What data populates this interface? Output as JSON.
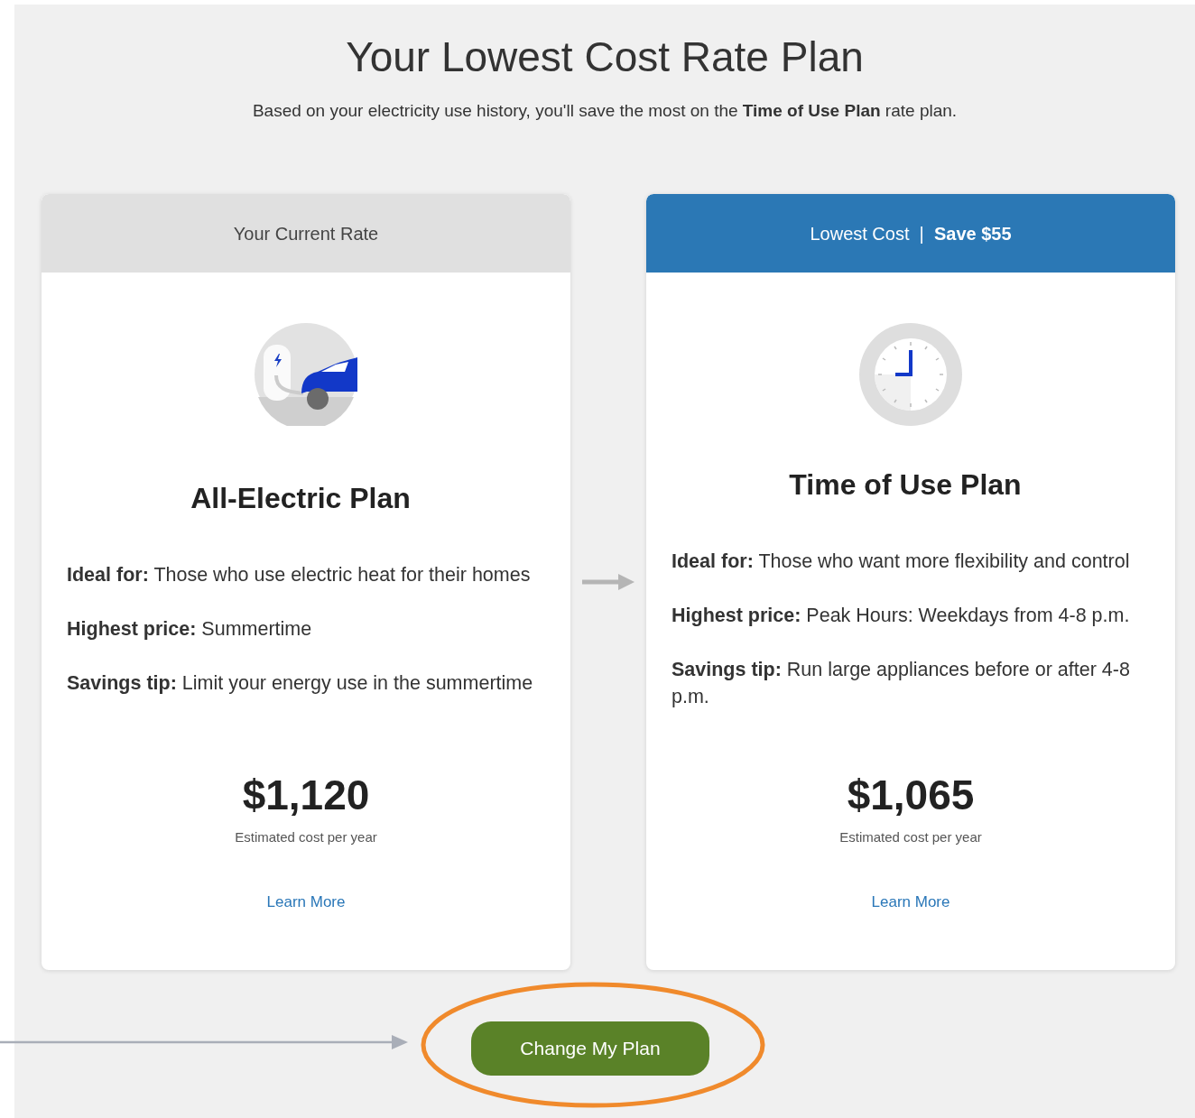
{
  "title": "Your Lowest Cost Rate Plan",
  "subtitle": "Based on your electricity use history, you'll save the most on the **Time of Use Plan** rate plan.",
  "plans": [
    {
      "kind": "current",
      "header": "Your Current Rate",
      "name": "All-Electric Plan",
      "details": [
        "**Ideal for:** Those who use electric heat for their homes",
        "**Highest price:** Summertime",
        "**Savings tip:** Limit your energy use in the summertime"
      ],
      "price": "$1,120",
      "price_note": "Estimated cost per year",
      "link": "Learn More"
    },
    {
      "kind": "lowest",
      "header": "Lowest Cost  |  **Save $55**",
      "name": "Time of Use Plan",
      "details": [
        "**Ideal for:** Those who want more flexibility and control",
        "**Highest price:** Peak Hours: Weekdays from 4-8 p.m.",
        "**Savings tip:** Run large appliances before or after 4-8 p.m."
      ],
      "price": "$1,065",
      "price_note": "Estimated cost per year",
      "link": "Learn More"
    }
  ],
  "button": {
    "label": "Change My Plan",
    "highlighted": true
  },
  "pointer_arrow": true
}
